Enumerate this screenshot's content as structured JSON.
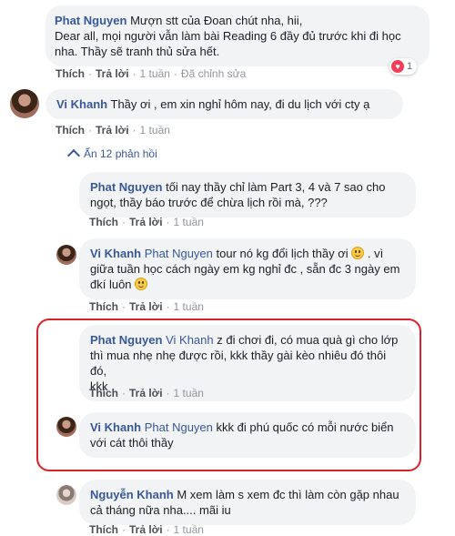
{
  "comments": [
    {
      "name": "Phat Nguyen",
      "text_line1": "Mượn stt của Đoan chút nha, hii,",
      "text_line2": "Dear all, mọi người vẫn làm bài Reading 6 đầy đủ trước khi đi học",
      "text_line3": "nha. Thầy sẽ tranh thủ sửa hết.",
      "like": "Thích",
      "reply": "Trả lời",
      "time": "1 tuần",
      "edited": "Đã chỉnh sửa",
      "reaction_count": "1"
    },
    {
      "name": "Vi Khanh",
      "text": "Thầy ơi , em xin nghỉ hôm nay, đi du lịch với cty ạ",
      "like": "Thích",
      "reply": "Trả lời",
      "time": "1 tuần",
      "replies_toggle": "Ẩn 12 phản hồi"
    }
  ],
  "replies": [
    {
      "name": "Phat Nguyen",
      "text_line1": "tối nay thầy chỉ làm Part 3, 4 và 7 sao cho",
      "text_line2": "ngọt, thầy báo trước để chừa lịch rồi mà, ???",
      "like": "Thích",
      "reply": "Trả lời",
      "time": "1 tuần"
    },
    {
      "name": "Vi Khanh",
      "tag": "Phat Nguyen",
      "text_line1": "tour nó kg đổi lịch thầy ơi",
      "text_line1_end": ". vì",
      "text_line2": "giữa tuần học cách ngày em kg nghỉ đc , sẵn đc 3 ngày em",
      "text_line3": "đkí luôn",
      "like": "Thích",
      "reply": "Trả lời",
      "time": "1 tuần"
    },
    {
      "name": "Phat Nguyen",
      "tag": "Vi Khanh",
      "text_line1": "z đi chơi đi, có mua quà gì cho lớp",
      "text_line2": "thì mua nhẹ nhẹ được rồi, kkk thầy gài kèo nhiêu đó thôi đó,",
      "text_line3": "kkk",
      "like": "Thích",
      "reply": "Trả lời",
      "time": "1 tuần"
    },
    {
      "name": "Vi Khanh",
      "tag": "Phat Nguyen",
      "text_line1": "kkk đi phú quốc có mỗi nước biển",
      "text_line2": "với cát thôi thầy",
      "like": "Thích",
      "reply": "Trả lời",
      "time": "1 tuần"
    },
    {
      "name": "Nguyễn Khanh",
      "text_line1": "M xem làm s xem đc thì làm còn gặp nhau",
      "text_line2": "cả tháng nữa nha.... mãi iu",
      "like": "Thích",
      "reply": "Trả lời",
      "time": "1 tuần"
    }
  ],
  "colors": {
    "name": "#385898",
    "highlight": "#d9222a",
    "bubble": "#f2f3f5"
  },
  "icons": {
    "reaction": "heart-reaction-icon",
    "emoji": "confused-face-emoji",
    "toggle": "chevron-up-icon"
  }
}
